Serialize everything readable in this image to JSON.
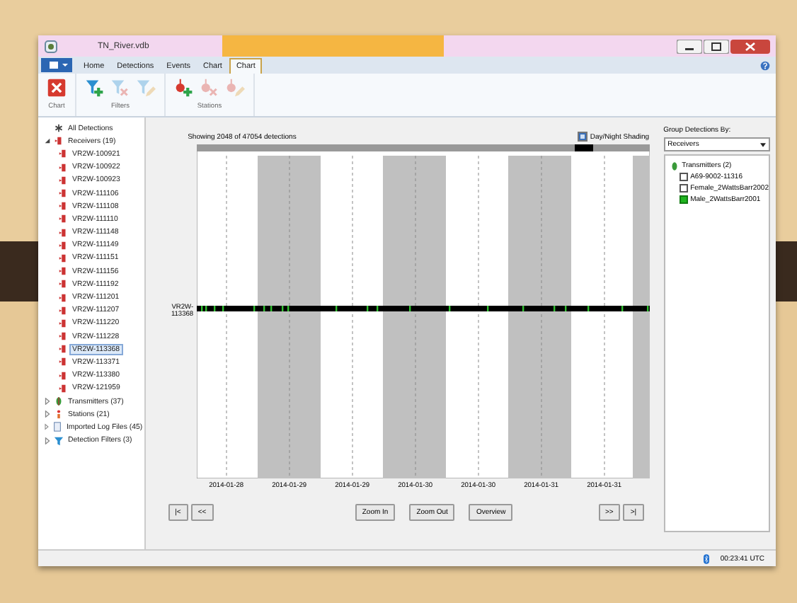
{
  "window": {
    "title": "TN_River.vdb"
  },
  "ribbon_tabs": [
    {
      "label": "Home",
      "selected": false
    },
    {
      "label": "Detections",
      "selected": false
    },
    {
      "label": "Events",
      "selected": false
    },
    {
      "label": "Chart",
      "selected": false
    },
    {
      "label": "Chart",
      "selected": true
    }
  ],
  "ribbon_groups": [
    {
      "label": "Chart",
      "tools": [
        {
          "kind": "delete",
          "disabled": false
        }
      ]
    },
    {
      "label": "Filters",
      "tools": [
        {
          "kind": "add",
          "disabled": false
        },
        {
          "kind": "remove",
          "disabled": true
        },
        {
          "kind": "edit",
          "disabled": true
        }
      ]
    },
    {
      "label": "Stations",
      "tools": [
        {
          "kind": "add",
          "disabled": false
        },
        {
          "kind": "remove",
          "disabled": true
        },
        {
          "kind": "edit",
          "disabled": true
        }
      ]
    }
  ],
  "tree": [
    {
      "label": "All Detections",
      "kind": "all"
    },
    {
      "label": "Receivers (19)",
      "kind": "receiver",
      "expanded": true,
      "children": [
        {
          "label": "VR2W-100921",
          "selected": false
        },
        {
          "label": "VR2W-100922",
          "selected": false
        },
        {
          "label": "VR2W-100923",
          "selected": false
        },
        {
          "label": "VR2W-111106",
          "selected": false
        },
        {
          "label": "VR2W-111108",
          "selected": false
        },
        {
          "label": "VR2W-111110",
          "selected": false
        },
        {
          "label": "VR2W-111148",
          "selected": false
        },
        {
          "label": "VR2W-111149",
          "selected": false
        },
        {
          "label": "VR2W-111151",
          "selected": false
        },
        {
          "label": "VR2W-111156",
          "selected": false
        },
        {
          "label": "VR2W-111192",
          "selected": false
        },
        {
          "label": "VR2W-111201",
          "selected": false
        },
        {
          "label": "VR2W-111207",
          "selected": false
        },
        {
          "label": "VR2W-111220",
          "selected": false
        },
        {
          "label": "VR2W-111228",
          "selected": false
        },
        {
          "label": "VR2W-113368",
          "selected": true
        },
        {
          "label": "VR2W-113371",
          "selected": false
        },
        {
          "label": "VR2W-113380",
          "selected": false
        },
        {
          "label": "VR2W-121959",
          "selected": false
        }
      ]
    },
    {
      "label": "Transmitters (37)",
      "kind": "transmitter",
      "expanded": false
    },
    {
      "label": "Stations (21)",
      "kind": "station",
      "expanded": false
    },
    {
      "label": "Imported Log Files (45)",
      "kind": "file",
      "expanded": false
    },
    {
      "label": "Detection Filters (3)",
      "kind": "filter",
      "expanded": false
    }
  ],
  "chart": {
    "caption": "Showing 2048 of 47054 detections",
    "shading": {
      "label": "Day/Night Shading",
      "checked": true
    },
    "row_label": "VR2W-113368",
    "x_labels": [
      "2014-01-28",
      "2014-01-29",
      "2014-01-29",
      "2014-01-30",
      "2014-01-30",
      "2014-01-31",
      "2014-01-31"
    ]
  },
  "nav_buttons": {
    "left": [
      "|<",
      "<<"
    ],
    "center": [
      "Zoom In",
      "Zoom Out",
      "Overview"
    ],
    "right": [
      ">>",
      ">|"
    ]
  },
  "group_panel": {
    "label": "Group Detections By:",
    "dropdown": "Receivers",
    "root": "Transmitters (2)",
    "items": [
      {
        "label": "A69-9002-11316",
        "checked": false
      },
      {
        "label": "Female_2WattsBarr2002",
        "checked": false
      },
      {
        "label": "Male_2WattsBarr2001",
        "checked": true
      }
    ]
  },
  "status_bar": {
    "time": "00:23:41 UTC"
  }
}
